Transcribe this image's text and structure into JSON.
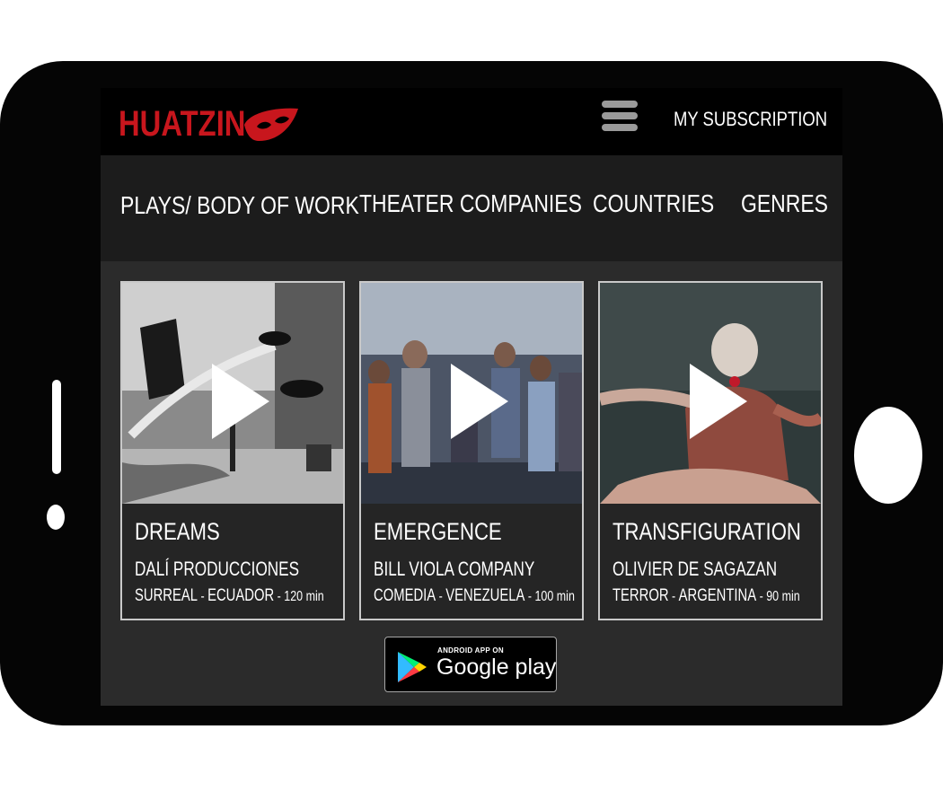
{
  "brand": {
    "name": "HUATZIN",
    "color": "#c8161d",
    "icon": "mask-icon"
  },
  "header": {
    "subscription_label": "MY SUBSCRIPTION",
    "menu_icon": "hamburger-menu-icon"
  },
  "nav": {
    "items": [
      {
        "label": "PLAYS/ BODY OF WORK"
      },
      {
        "label": "THEATER COMPANIES"
      },
      {
        "label": "COUNTRIES"
      },
      {
        "label": "GENRES"
      }
    ]
  },
  "cards": [
    {
      "title": "DREAMS",
      "company": "DALÍ PRODUCCIONES",
      "genre": "SURREAL",
      "country": "ECUADOR",
      "duration": "120 min",
      "sep": " - "
    },
    {
      "title": "EMERGENCE",
      "company": "BILL VIOLA COMPANY",
      "genre": "COMEDIA",
      "country": "VENEZUELA",
      "duration": "100 min",
      "sep": " - "
    },
    {
      "title": "TRANSFIGURATION",
      "company": "OLIVIER DE SAGAZAN",
      "genre": "TERROR",
      "country": "ARGENTINA",
      "duration": "90 min",
      "sep": " - "
    }
  ],
  "store_badge": {
    "small": "ANDROID APP ON",
    "big": "Google play",
    "icon": "google-play-logo-icon"
  }
}
